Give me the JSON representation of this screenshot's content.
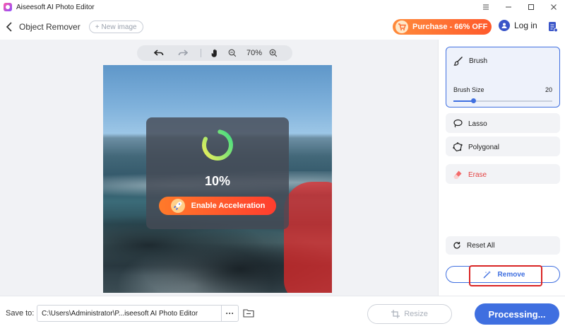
{
  "window": {
    "title": "Aiseesoft AI Photo Editor"
  },
  "header": {
    "page_title": "Object Remover",
    "new_image_label": "New image",
    "purchase_label": "Purchase - 66% OFF",
    "login_label": "Log in"
  },
  "toolbar": {
    "zoom_level": "70%"
  },
  "progress": {
    "percent_text": "10%",
    "percent_value": 0.1,
    "accelerate_label": "Enable Acceleration"
  },
  "panel": {
    "brush_label": "Brush",
    "brush_size_label": "Brush Size",
    "brush_size_value": "20",
    "lasso_label": "Lasso",
    "polygonal_label": "Polygonal",
    "erase_label": "Erase",
    "reset_label": "Reset All",
    "remove_label": "Remove"
  },
  "footer": {
    "save_to_label": "Save to:",
    "save_path": "C:\\Users\\Administrator\\P...iseesoft AI Photo Editor",
    "dots_label": "···",
    "resize_label": "Resize",
    "processing_label": "Processing..."
  },
  "colors": {
    "accent": "#3f6fe0",
    "purchase": "#ff6a2e",
    "erase": "#e44141",
    "mask": "#e62828"
  }
}
